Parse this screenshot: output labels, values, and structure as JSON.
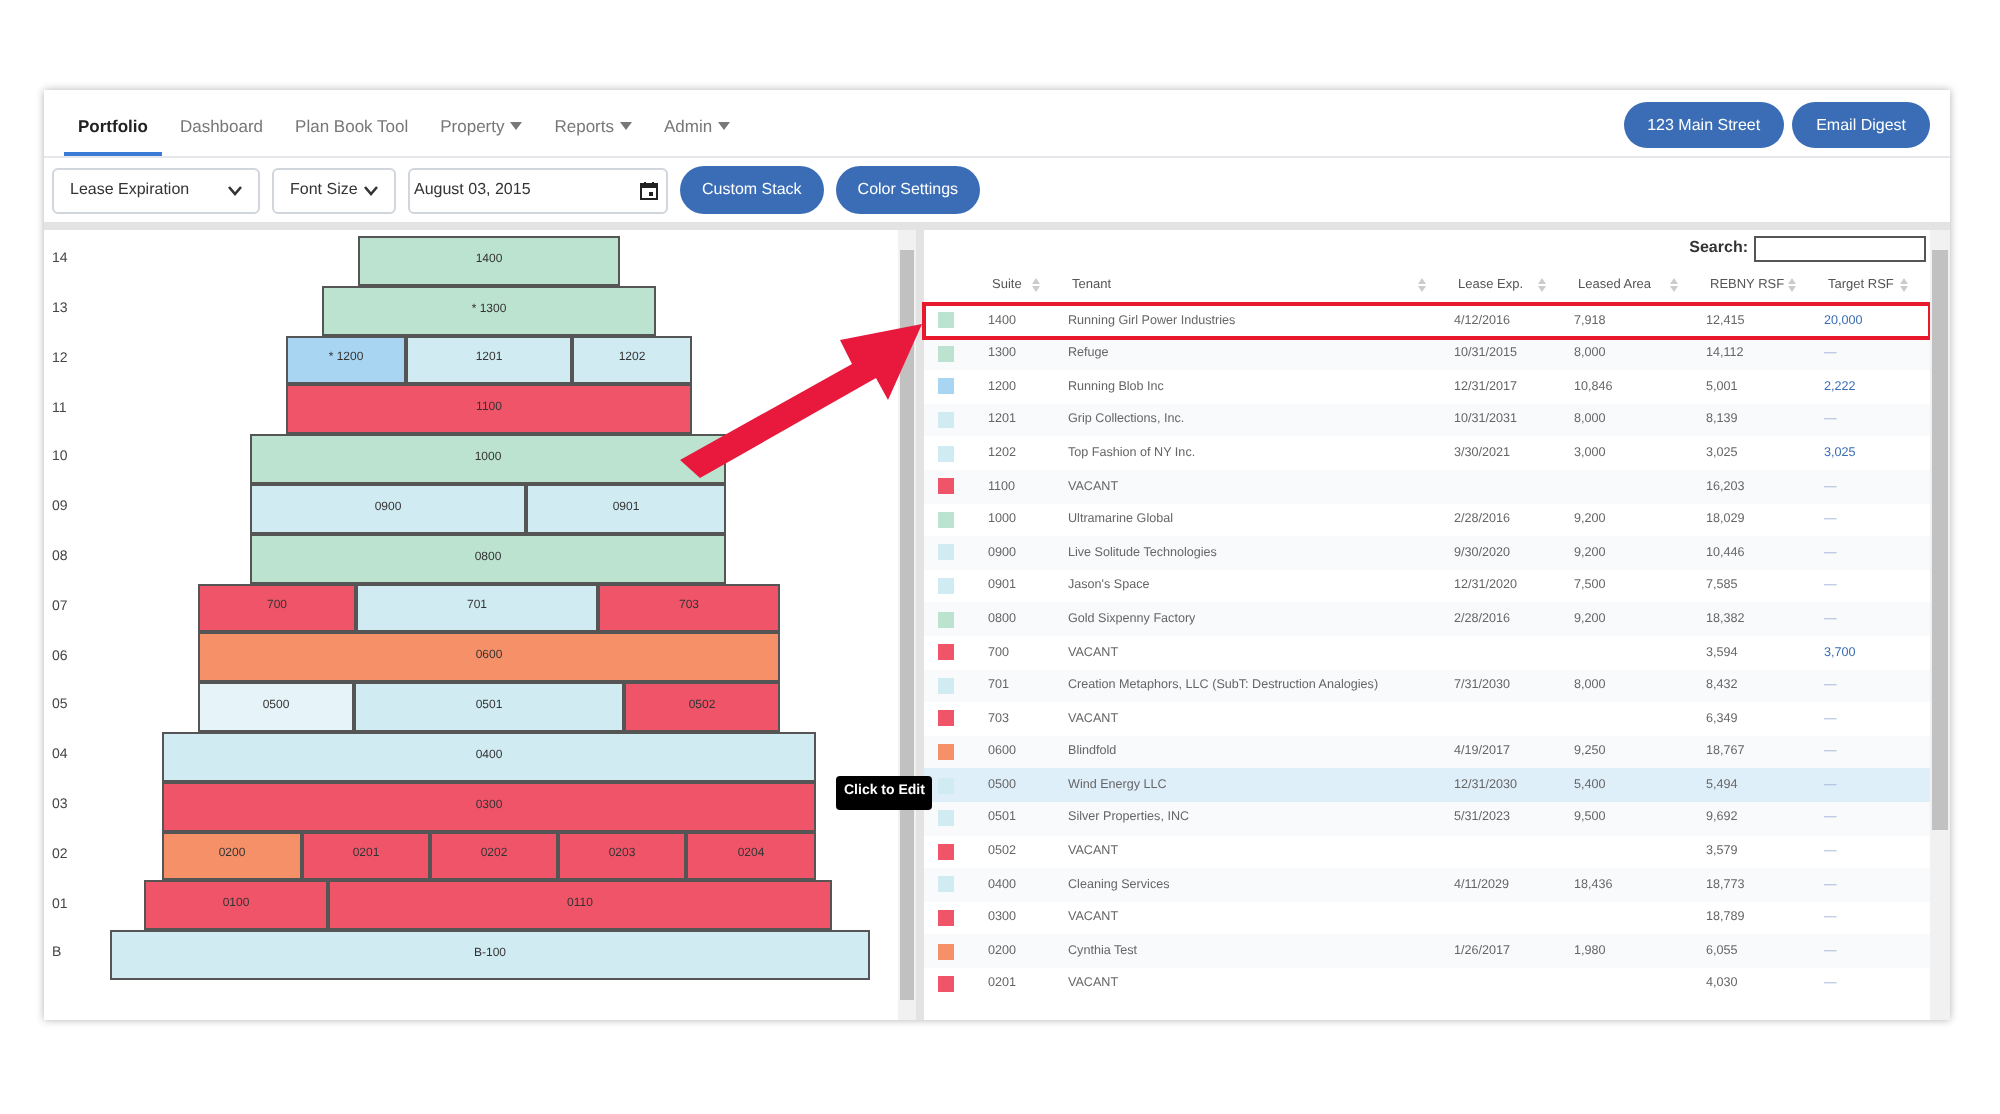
{
  "tabs": [
    {
      "label": "Portfolio",
      "selected": true,
      "dropdown": false
    },
    {
      "label": "Dashboard",
      "selected": false,
      "dropdown": false
    },
    {
      "label": "Plan Book Tool",
      "selected": false,
      "dropdown": false
    },
    {
      "label": "Property",
      "selected": false,
      "dropdown": true
    },
    {
      "label": "Reports",
      "selected": false,
      "dropdown": true
    },
    {
      "label": "Admin",
      "selected": false,
      "dropdown": true
    }
  ],
  "header_buttons": [
    "123 Main Street",
    "Email Digest"
  ],
  "toolbar": {
    "view_select": "Lease Expiration",
    "font_select": "Font Size",
    "date": "August 03, 2015",
    "buttons": [
      "Custom Stack",
      "Color Settings"
    ]
  },
  "stack": {
    "floors": [
      {
        "label": "14",
        "suites": [
          {
            "label": "1400",
            "color": "#bce3d0"
          }
        ]
      },
      {
        "label": "13",
        "suites": [
          {
            "label": "* 1300",
            "color": "#bce3d0"
          }
        ]
      },
      {
        "label": "12",
        "suites": [
          {
            "label": "* 1200",
            "color": "#a8d6f2"
          },
          {
            "label": "1201",
            "color": "#d0ebf2"
          },
          {
            "label": "1202",
            "color": "#d0ebf2"
          }
        ]
      },
      {
        "label": "11",
        "suites": [
          {
            "label": "1100",
            "color": "#f05468"
          }
        ]
      },
      {
        "label": "10",
        "suites": [
          {
            "label": "1000",
            "color": "#bce3d0"
          }
        ]
      },
      {
        "label": "09",
        "suites": [
          {
            "label": "0900",
            "color": "#d0ebf2"
          },
          {
            "label": "0901",
            "color": "#d0ebf2"
          }
        ]
      },
      {
        "label": "08",
        "suites": [
          {
            "label": "0800",
            "color": "#bce3d0"
          }
        ]
      },
      {
        "label": "07",
        "suites": [
          {
            "label": "700",
            "color": "#f05468"
          },
          {
            "label": "701",
            "color": "#d0ebf2"
          },
          {
            "label": "703",
            "color": "#f05468"
          }
        ]
      },
      {
        "label": "06",
        "suites": [
          {
            "label": "0600",
            "color": "#f59069"
          }
        ]
      },
      {
        "label": "05",
        "suites": [
          {
            "label": "0500",
            "color": "#e6f4f9"
          },
          {
            "label": "0501",
            "color": "#d0ebf2"
          },
          {
            "label": "0502",
            "color": "#f05468"
          }
        ]
      },
      {
        "label": "04",
        "suites": [
          {
            "label": "0400",
            "color": "#d0ebf2"
          }
        ]
      },
      {
        "label": "03",
        "suites": [
          {
            "label": "0300",
            "color": "#f05468"
          }
        ]
      },
      {
        "label": "02",
        "suites": [
          {
            "label": "0200",
            "color": "#f59069"
          },
          {
            "label": "0201",
            "color": "#f05468"
          },
          {
            "label": "0202",
            "color": "#f05468"
          },
          {
            "label": "0203",
            "color": "#f05468"
          },
          {
            "label": "0204",
            "color": "#f05468"
          }
        ]
      },
      {
        "label": "01",
        "suites": [
          {
            "label": "0100",
            "color": "#f05468"
          },
          {
            "label": "0110",
            "color": "#f05468"
          }
        ]
      },
      {
        "label": "B",
        "suites": [
          {
            "label": "B-100",
            "color": "#d0ebf2"
          }
        ]
      }
    ],
    "tooltip": "Click to Edit"
  },
  "table": {
    "search_label": "Search:",
    "columns": [
      "Suite",
      "Tenant",
      "Lease Exp.",
      "Leased Area",
      "REBNY RSF",
      "Target RSF"
    ],
    "rows": [
      {
        "color": "#bce3d0",
        "suite": "1400",
        "tenant": "Running Girl Power Industries",
        "lease_exp": "4/12/2016",
        "leased_area": "7,918",
        "rebny_rsf": "12,415",
        "target_rsf": "20,000",
        "target_set": true,
        "selected": true,
        "hovered": false
      },
      {
        "color": "#bce3d0",
        "suite": "1300",
        "tenant": "Refuge",
        "lease_exp": "10/31/2015",
        "leased_area": "8,000",
        "rebny_rsf": "14,112",
        "target_rsf": "—",
        "target_set": false,
        "selected": false,
        "hovered": false
      },
      {
        "color": "#a8d6f2",
        "suite": "1200",
        "tenant": "Running Blob Inc",
        "lease_exp": "12/31/2017",
        "leased_area": "10,846",
        "rebny_rsf": "5,001",
        "target_rsf": "2,222",
        "target_set": true,
        "selected": false,
        "hovered": false
      },
      {
        "color": "#d0ebf2",
        "suite": "1201",
        "tenant": "Grip Collections, Inc.",
        "lease_exp": "10/31/2031",
        "leased_area": "8,000",
        "rebny_rsf": "8,139",
        "target_rsf": "—",
        "target_set": false,
        "selected": false,
        "hovered": false
      },
      {
        "color": "#d0ebf2",
        "suite": "1202",
        "tenant": "Top Fashion of NY Inc.",
        "lease_exp": "3/30/2021",
        "leased_area": "3,000",
        "rebny_rsf": "3,025",
        "target_rsf": "3,025",
        "target_set": true,
        "selected": false,
        "hovered": false
      },
      {
        "color": "#f05468",
        "suite": "1100",
        "tenant": "VACANT",
        "lease_exp": "",
        "leased_area": "",
        "rebny_rsf": "16,203",
        "target_rsf": "—",
        "target_set": false,
        "selected": false,
        "hovered": false
      },
      {
        "color": "#bce3d0",
        "suite": "1000",
        "tenant": "Ultramarine Global",
        "lease_exp": "2/28/2016",
        "leased_area": "9,200",
        "rebny_rsf": "18,029",
        "target_rsf": "—",
        "target_set": false,
        "selected": false,
        "hovered": false
      },
      {
        "color": "#d0ebf2",
        "suite": "0900",
        "tenant": "Live Solitude Technologies",
        "lease_exp": "9/30/2020",
        "leased_area": "9,200",
        "rebny_rsf": "10,446",
        "target_rsf": "—",
        "target_set": false,
        "selected": false,
        "hovered": false
      },
      {
        "color": "#d0ebf2",
        "suite": "0901",
        "tenant": "Jason's Space",
        "lease_exp": "12/31/2020",
        "leased_area": "7,500",
        "rebny_rsf": "7,585",
        "target_rsf": "—",
        "target_set": false,
        "selected": false,
        "hovered": false
      },
      {
        "color": "#bce3d0",
        "suite": "0800",
        "tenant": "Gold Sixpenny Factory",
        "lease_exp": "2/28/2016",
        "leased_area": "9,200",
        "rebny_rsf": "18,382",
        "target_rsf": "—",
        "target_set": false,
        "selected": false,
        "hovered": false
      },
      {
        "color": "#f05468",
        "suite": "700",
        "tenant": "VACANT",
        "lease_exp": "",
        "leased_area": "",
        "rebny_rsf": "3,594",
        "target_rsf": "3,700",
        "target_set": true,
        "selected": false,
        "hovered": false
      },
      {
        "color": "#d0ebf2",
        "suite": "701",
        "tenant": "Creation Metaphors, LLC (SubT: Destruction Analogies)",
        "lease_exp": "7/31/2030",
        "leased_area": "8,000",
        "rebny_rsf": "8,432",
        "target_rsf": "—",
        "target_set": false,
        "selected": false,
        "hovered": false
      },
      {
        "color": "#f05468",
        "suite": "703",
        "tenant": "VACANT",
        "lease_exp": "",
        "leased_area": "",
        "rebny_rsf": "6,349",
        "target_rsf": "—",
        "target_set": false,
        "selected": false,
        "hovered": false
      },
      {
        "color": "#f59069",
        "suite": "0600",
        "tenant": "Blindfold",
        "lease_exp": "4/19/2017",
        "leased_area": "9,250",
        "rebny_rsf": "18,767",
        "target_rsf": "—",
        "target_set": false,
        "selected": false,
        "hovered": false
      },
      {
        "color": "#d0ebf2",
        "suite": "0500",
        "tenant": "Wind Energy LLC",
        "lease_exp": "12/31/2030",
        "leased_area": "5,400",
        "rebny_rsf": "5,494",
        "target_rsf": "—",
        "target_set": false,
        "selected": false,
        "hovered": true
      },
      {
        "color": "#d0ebf2",
        "suite": "0501",
        "tenant": "Silver Properties, INC",
        "lease_exp": "5/31/2023",
        "leased_area": "9,500",
        "rebny_rsf": "9,692",
        "target_rsf": "—",
        "target_set": false,
        "selected": false,
        "hovered": false
      },
      {
        "color": "#f05468",
        "suite": "0502",
        "tenant": "VACANT",
        "lease_exp": "",
        "leased_area": "",
        "rebny_rsf": "3,579",
        "target_rsf": "—",
        "target_set": false,
        "selected": false,
        "hovered": false
      },
      {
        "color": "#d0ebf2",
        "suite": "0400",
        "tenant": "Cleaning Services",
        "lease_exp": "4/11/2029",
        "leased_area": "18,436",
        "rebny_rsf": "18,773",
        "target_rsf": "—",
        "target_set": false,
        "selected": false,
        "hovered": false
      },
      {
        "color": "#f05468",
        "suite": "0300",
        "tenant": "VACANT",
        "lease_exp": "",
        "leased_area": "",
        "rebny_rsf": "18,789",
        "target_rsf": "—",
        "target_set": false,
        "selected": false,
        "hovered": false
      },
      {
        "color": "#f59069",
        "suite": "0200",
        "tenant": "Cynthia Test",
        "lease_exp": "1/26/2017",
        "leased_area": "1,980",
        "rebny_rsf": "6,055",
        "target_rsf": "—",
        "target_set": false,
        "selected": false,
        "hovered": false
      },
      {
        "color": "#f05468",
        "suite": "0201",
        "tenant": "VACANT",
        "lease_exp": "",
        "leased_area": "",
        "rebny_rsf": "4,030",
        "target_rsf": "—",
        "target_set": false,
        "selected": false,
        "hovered": false
      }
    ]
  }
}
